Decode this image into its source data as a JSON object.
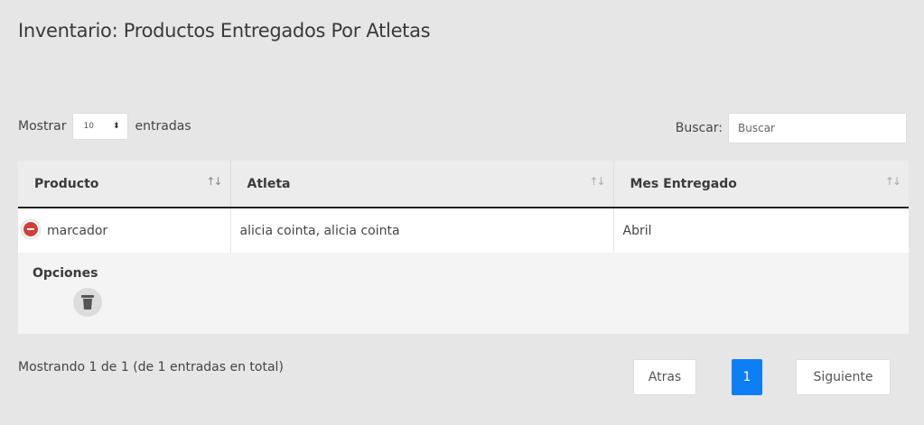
{
  "page": {
    "title": "Inventario: Productos Entregados Por Atletas"
  },
  "length_menu": {
    "prefix": "Mostrar",
    "value": "10",
    "suffix": "entradas"
  },
  "search": {
    "label": "Buscar:",
    "placeholder": "Buscar",
    "value": ""
  },
  "table": {
    "columns": [
      "Producto",
      "Atleta",
      "Mes Entregado"
    ],
    "sort_glyph": "↑↓",
    "rows": [
      {
        "producto": "marcador",
        "atleta": "alicia cointa, alicia cointa",
        "mes": "Abril"
      }
    ],
    "details": {
      "label": "Opciones"
    }
  },
  "info": "Mostrando 1 de 1 (de 1 entradas en total)",
  "pagination": {
    "prev": "Atras",
    "current": "1",
    "next": "Siguiente"
  },
  "colors": {
    "accent": "#0d7ef5",
    "toggle": "#d43f3a",
    "background": "#e6e6e6"
  }
}
